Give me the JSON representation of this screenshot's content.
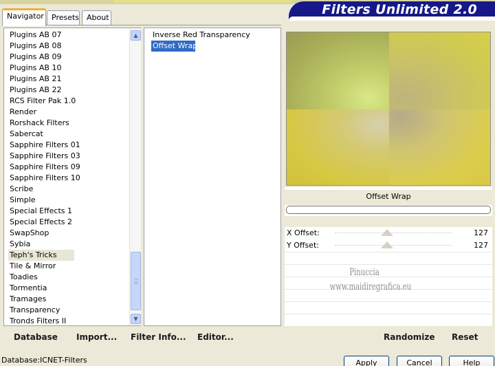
{
  "banner": {
    "title": "Filters Unlimited 2.0"
  },
  "tabs": [
    {
      "label": "Navigator",
      "active": true
    },
    {
      "label": "Presets",
      "active": false
    },
    {
      "label": "About",
      "active": false
    }
  ],
  "categories": {
    "items": [
      "Plugins AB 07",
      "Plugins AB 08",
      "Plugins AB 09",
      "Plugins AB 10",
      "Plugins AB 21",
      "Plugins AB 22",
      "RCS Filter Pak 1.0",
      "Render",
      "Rorshack Filters",
      "Sabercat",
      "Sapphire Filters 01",
      "Sapphire Filters 03",
      "Sapphire Filters 09",
      "Sapphire Filters 10",
      "Scribe",
      "Simple",
      "Special Effects 1",
      "Special Effects 2",
      "SwapShop",
      "Sybia",
      "Teph's Tricks",
      "Tile & Mirror",
      "Toadies",
      "Tormentia",
      "Tramages",
      "Transparency",
      "Tronds Filters II"
    ],
    "selected": "Teph's Tricks"
  },
  "filters": {
    "items": [
      "Inverse Red Transparency",
      "Offset Wrap"
    ],
    "selected": "Offset Wrap"
  },
  "preview": {
    "filter_name": "Offset Wrap",
    "colors": [
      "#c3ce6a",
      "#cfca52",
      "#d6c841",
      "#dccd4c"
    ]
  },
  "params": [
    {
      "label": "X Offset:",
      "value": "127"
    },
    {
      "label": "Y Offset:",
      "value": "127"
    }
  ],
  "watermark": {
    "line1": "Pinuccia",
    "line2": "www.maidiregrafica.eu"
  },
  "bottom_left": {
    "database_label": "Database",
    "import_label": "Import...",
    "filter_info_label": "Filter Info...",
    "editor_label": "Editor..."
  },
  "bottom_right": {
    "randomize_label": "Randomize",
    "reset_label": "Reset"
  },
  "status": {
    "label": "Database:",
    "value": "ICNET-Filters"
  },
  "dialog_buttons": {
    "apply": "Apply",
    "cancel": "Cancel",
    "help": "Help"
  }
}
